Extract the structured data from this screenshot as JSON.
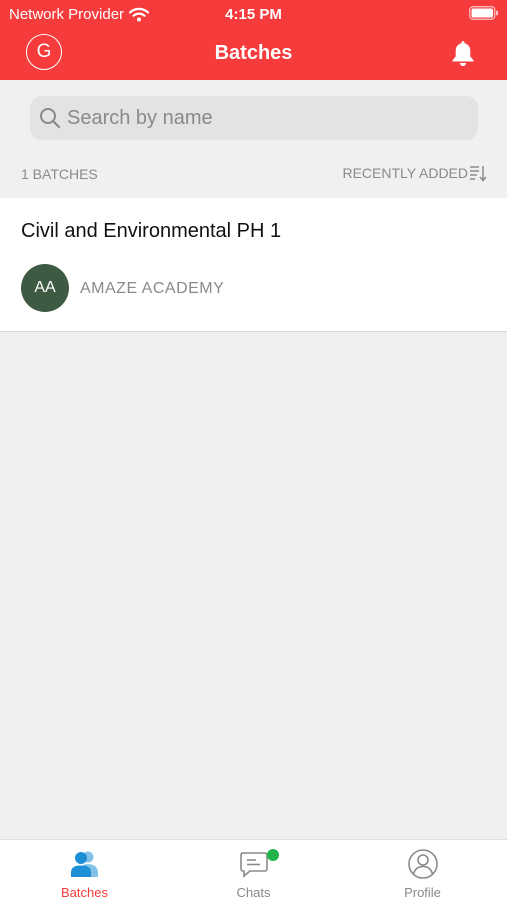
{
  "status_bar": {
    "carrier": "Network Provider",
    "time": "4:15 PM"
  },
  "header": {
    "avatar_initial": "G",
    "title": "Batches"
  },
  "search": {
    "placeholder": "Search by name",
    "value": ""
  },
  "list_header": {
    "count_label": "1 BATCHES",
    "sort_label": "RECENTLY ADDED"
  },
  "batches": [
    {
      "title": "Civil and Environmental PH 1",
      "academy_initials": "AA",
      "academy_name": "AMAZE ACADEMY"
    }
  ],
  "tabs": [
    {
      "label": "Batches",
      "icon": "people-icon",
      "active": true
    },
    {
      "label": "Chats",
      "icon": "chat-icon",
      "active": false,
      "badge": true
    },
    {
      "label": "Profile",
      "icon": "profile-icon",
      "active": false
    }
  ],
  "colors": {
    "brand": "#f53b3b",
    "academy_avatar": "#3f5a43",
    "tab_active_icon": "#1e8fd6",
    "badge": "#22b34a",
    "background": "#f0f0f0"
  }
}
